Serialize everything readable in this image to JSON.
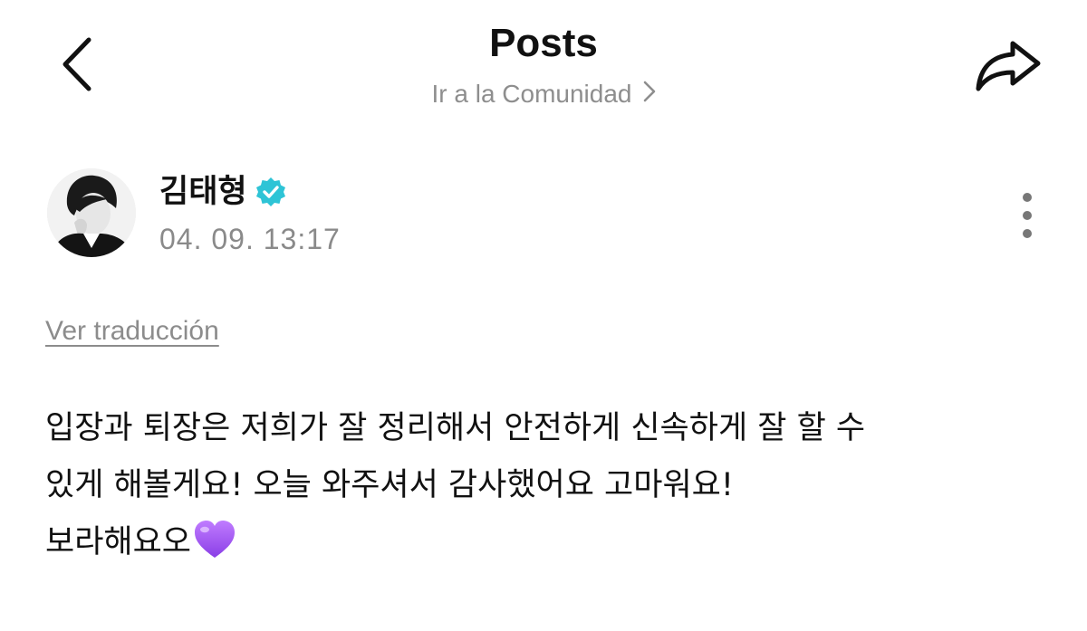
{
  "header": {
    "title": "Posts",
    "community_link": "Ir a la Comunidad",
    "back_icon": "chevron-left-icon",
    "share_icon": "share-arrow-icon"
  },
  "post": {
    "author": {
      "name": "김태형",
      "verified": true,
      "verified_color": "#2ec4d6",
      "avatar_icon": "profile-photo"
    },
    "timestamp": "04. 09. 13:17",
    "more_icon": "more-vertical-icon",
    "translate_label": "Ver traducción",
    "body": {
      "line1": "입장과 퇴장은 저희가 잘 정리해서 안전하게 신속하게 잘 할 수",
      "line2": "있게 해볼게요! 오늘 와주셔서 감사했어요 고마워요!",
      "line3": "보라해요오",
      "emoji": "purple-heart",
      "emoji_color": "#a35bf0"
    }
  }
}
